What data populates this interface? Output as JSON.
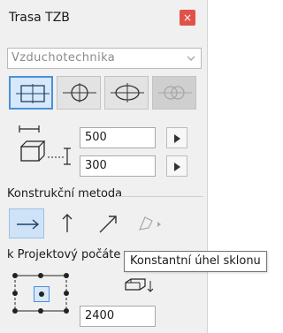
{
  "window": {
    "title": "Trasa TZB",
    "close_label": "×"
  },
  "system_select": {
    "value": "Vzduchotechnika"
  },
  "shape_buttons": [
    {
      "icon": "rectangular-duct-icon",
      "selected": true
    },
    {
      "icon": "circular-duct-icon",
      "selected": false
    },
    {
      "icon": "oval-duct-icon",
      "selected": false
    },
    {
      "icon": "flexible-duct-icon",
      "enabled": false
    }
  ],
  "dimensions": {
    "width_value": "500",
    "height_value": "300"
  },
  "construction": {
    "label": "Konstrukční metoda",
    "methods": [
      {
        "icon": "arrow-right-icon",
        "selected": true
      },
      {
        "icon": "arrow-up-icon",
        "selected": false
      },
      {
        "icon": "arrow-diagonal-icon",
        "selected": false
      },
      {
        "icon": "curved-route-icon",
        "enabled": false
      }
    ]
  },
  "project": {
    "label": "k Projektový počáte"
  },
  "tooltip": {
    "text": "Konstantní úhel sklonu"
  },
  "elevation": {
    "value": "2400"
  },
  "colors": {
    "accent": "#4a90d9",
    "close": "#e0524a",
    "active_fill": "#d6e8fa"
  }
}
